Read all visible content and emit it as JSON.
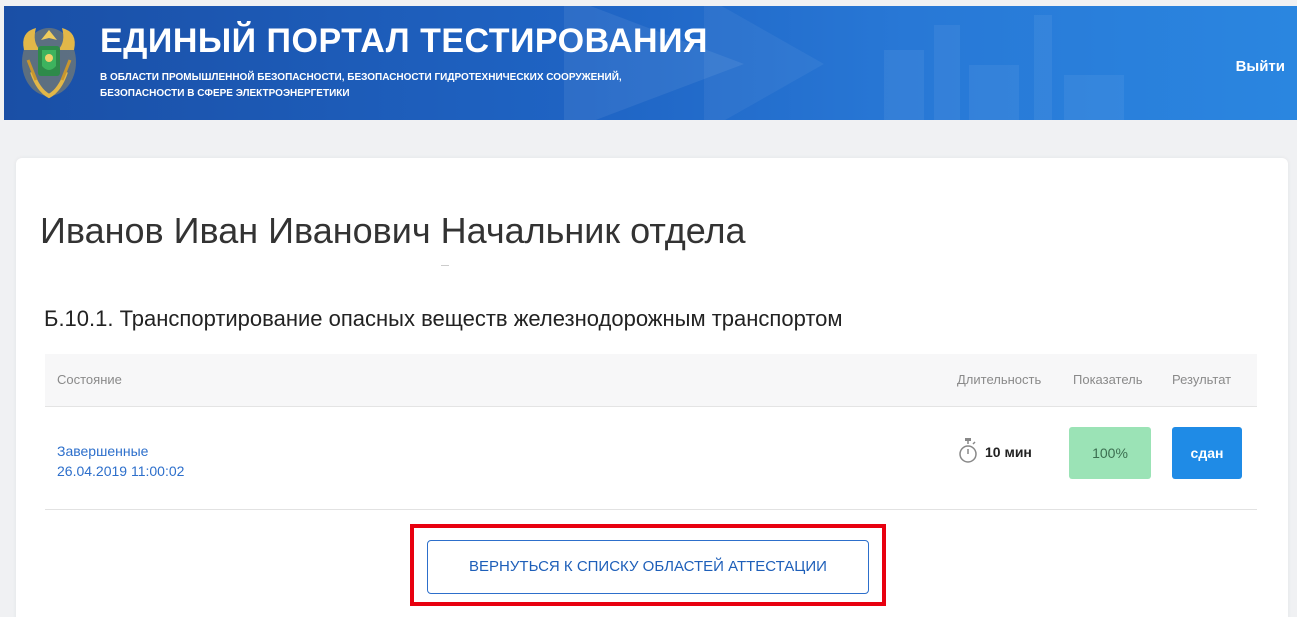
{
  "header": {
    "title": "ЕДИНЫЙ ПОРТАЛ ТЕСТИРОВАНИЯ",
    "subtitle_line1": "В ОБЛАСТИ ПРОМЫШЛЕННОЙ БЕЗОПАСНОСТИ, БЕЗОПАСНОСТИ ГИДРОТЕХНИЧЕСКИХ СООРУЖЕНИЙ,",
    "subtitle_line2": "БЕЗОПАСНОСТИ В СФЕРЕ ЭЛЕКТРОЭНЕРГЕТИКИ",
    "logout_label": "Выйти",
    "logo_icon": "emblem-icon"
  },
  "main": {
    "person": "Иванов Иван Иванович Начальник отдела",
    "area_title": "Б.10.1. Транспортирование опасных веществ железнодорожным транспортом",
    "table": {
      "columns": [
        "Состояние",
        "Длительность",
        "Показатель",
        "Результат"
      ],
      "rows": [
        {
          "status": "Завершенные",
          "datetime": "26.04.2019 11:00:02",
          "duration_icon": "stopwatch-icon",
          "duration": "10 мин",
          "score": "100%",
          "result": "сдан"
        }
      ]
    },
    "back_button": "ВЕРНУТЬСЯ К СПИСКУ ОБЛАСТЕЙ АТТЕСТАЦИИ"
  },
  "colors": {
    "header_blue": "#1f64c4",
    "link_blue": "#2d6fcb",
    "score_green": "#9be3b6",
    "result_blue": "#1f8be6",
    "highlight_red": "#e8000f"
  }
}
